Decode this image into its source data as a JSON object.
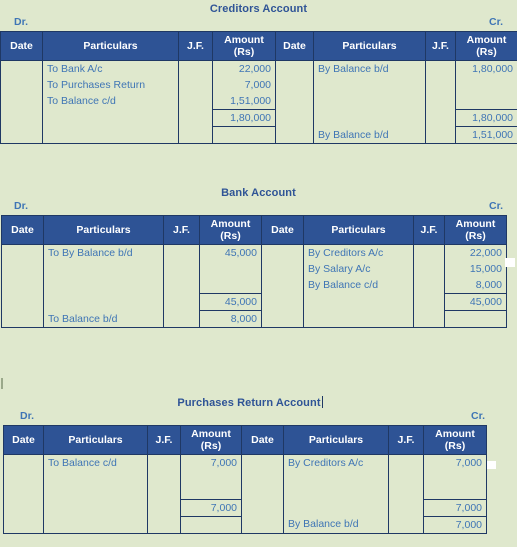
{
  "document": {
    "background_color": "#dfe8cd",
    "header_color": "#2e5395",
    "text_color": "#3f75b5",
    "title_color": "#2f5496",
    "border_color": "#1f3864"
  },
  "columns": {
    "date": "Date",
    "particulars": "Particulars",
    "jf": "J.F.",
    "amount_line1": "Amount",
    "amount_line2": "(Rs)"
  },
  "labels": {
    "dr": "Dr.",
    "cr": "Cr."
  },
  "ledgers": [
    {
      "title": "Creditors Account",
      "has_caret": false,
      "debit": {
        "entries": [
          {
            "date": "",
            "particulars": "To Bank A/c",
            "jf": "",
            "amount": "22,000"
          },
          {
            "date": "",
            "particulars": "To Purchases Return",
            "jf": "",
            "amount": "7,000"
          },
          {
            "date": "",
            "particulars": "To Balance c/d",
            "jf": "",
            "amount": "1,51,000"
          }
        ],
        "total": {
          "date": "",
          "particulars": "",
          "jf": "",
          "amount": "1,80,000"
        },
        "after_total": {
          "date": "",
          "particulars": "",
          "jf": "",
          "amount": ""
        }
      },
      "credit": {
        "entries": [
          {
            "date": "",
            "particulars": "By Balance b/d",
            "jf": "",
            "amount": "1,80,000"
          },
          {
            "date": "",
            "particulars": "",
            "jf": "",
            "amount": ""
          },
          {
            "date": "",
            "particulars": "",
            "jf": "",
            "amount": ""
          }
        ],
        "total": {
          "date": "",
          "particulars": "",
          "jf": "",
          "amount": "1,80,000"
        },
        "after_total": {
          "date": "",
          "particulars": "By Balance b/d",
          "jf": "",
          "amount": "1,51,000"
        }
      }
    },
    {
      "title": "Bank Account",
      "has_caret": false,
      "debit": {
        "entries": [
          {
            "date": "",
            "particulars": "To By Balance b/d",
            "jf": "",
            "amount": "45,000"
          },
          {
            "date": "",
            "particulars": "",
            "jf": "",
            "amount": ""
          },
          {
            "date": "",
            "particulars": "",
            "jf": "",
            "amount": ""
          }
        ],
        "total": {
          "date": "",
          "particulars": "",
          "jf": "",
          "amount": "45,000"
        },
        "after_total": {
          "date": "",
          "particulars": "To Balance b/d",
          "jf": "",
          "amount": "8,000"
        }
      },
      "credit": {
        "entries": [
          {
            "date": "",
            "particulars": "By Creditors A/c",
            "jf": "",
            "amount": "22,000"
          },
          {
            "date": "",
            "particulars": "By Salary A/c",
            "jf": "",
            "amount": "15,000"
          },
          {
            "date": "",
            "particulars": "By Balance c/d",
            "jf": "",
            "amount": "8,000"
          }
        ],
        "total": {
          "date": "",
          "particulars": "",
          "jf": "",
          "amount": "45,000"
        },
        "after_total": {
          "date": "",
          "particulars": "",
          "jf": "",
          "amount": ""
        }
      }
    },
    {
      "title": "Purchases Return Account",
      "has_caret": true,
      "debit": {
        "entries": [
          {
            "date": "",
            "particulars": "To Balance c/d",
            "jf": "",
            "amount": "7,000"
          },
          {
            "date": "",
            "particulars": "",
            "jf": "",
            "amount": ""
          },
          {
            "date": "",
            "particulars": "",
            "jf": "",
            "amount": ""
          }
        ],
        "total": {
          "date": "",
          "particulars": "",
          "jf": "",
          "amount": "7,000"
        },
        "after_total": {
          "date": "",
          "particulars": "",
          "jf": "",
          "amount": ""
        }
      },
      "credit": {
        "entries": [
          {
            "date": "",
            "particulars": "By Creditors A/c",
            "jf": "",
            "amount": "7,000"
          },
          {
            "date": "",
            "particulars": "",
            "jf": "",
            "amount": ""
          },
          {
            "date": "",
            "particulars": "",
            "jf": "",
            "amount": ""
          }
        ],
        "total": {
          "date": "",
          "particulars": "",
          "jf": "",
          "amount": "7,000"
        },
        "after_total": {
          "date": "",
          "particulars": "By Balance b/d",
          "jf": "",
          "amount": "7,000"
        }
      }
    }
  ]
}
